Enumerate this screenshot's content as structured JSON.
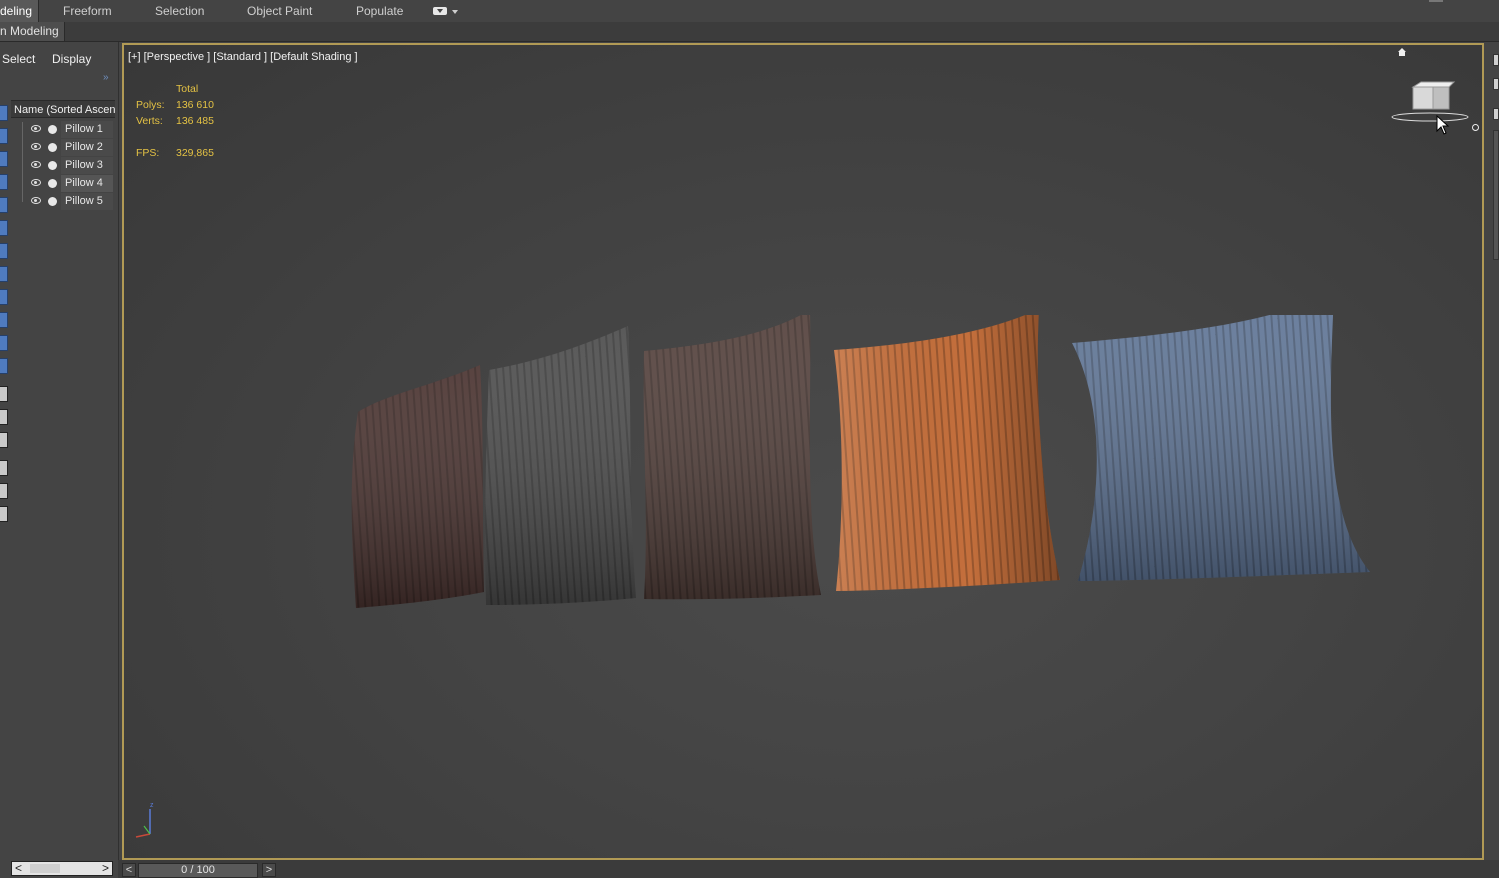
{
  "ribbon": {
    "tabs": [
      "deling",
      "Freeform",
      "Selection",
      "Object Paint",
      "Populate"
    ],
    "active_tab": "deling",
    "sub_label": "n Modeling"
  },
  "explorer": {
    "tabs": [
      "Select",
      "Display"
    ],
    "column_header": "Name (Sorted Ascen",
    "items": [
      {
        "label": "Pillow 1"
      },
      {
        "label": "Pillow 2"
      },
      {
        "label": "Pillow 3"
      },
      {
        "label": "Pillow 4"
      },
      {
        "label": "Pillow 5"
      }
    ]
  },
  "viewport": {
    "label": "[+] [Perspective ] [Standard ] [Default Shading ]",
    "stats": {
      "header": "Total",
      "polys_label": "Polys:",
      "polys_value": "136 610",
      "verts_label": "Verts:",
      "verts_value": "136 485",
      "fps_label": "FPS:",
      "fps_value": "329,865"
    },
    "pillow_colors": [
      "#4a3330",
      "#4c4c4c",
      "#53403b",
      "#c46f3c",
      "#5f7596"
    ]
  },
  "timeline": {
    "prev": "<",
    "frame": "0 / 100",
    "next": ">"
  },
  "icons": [
    "eye-icon",
    "render-dot-icon",
    "viewcube-icon",
    "home-icon",
    "axis-tripod-icon",
    "cursor-icon",
    "dropdown-arrow-icon"
  ]
}
